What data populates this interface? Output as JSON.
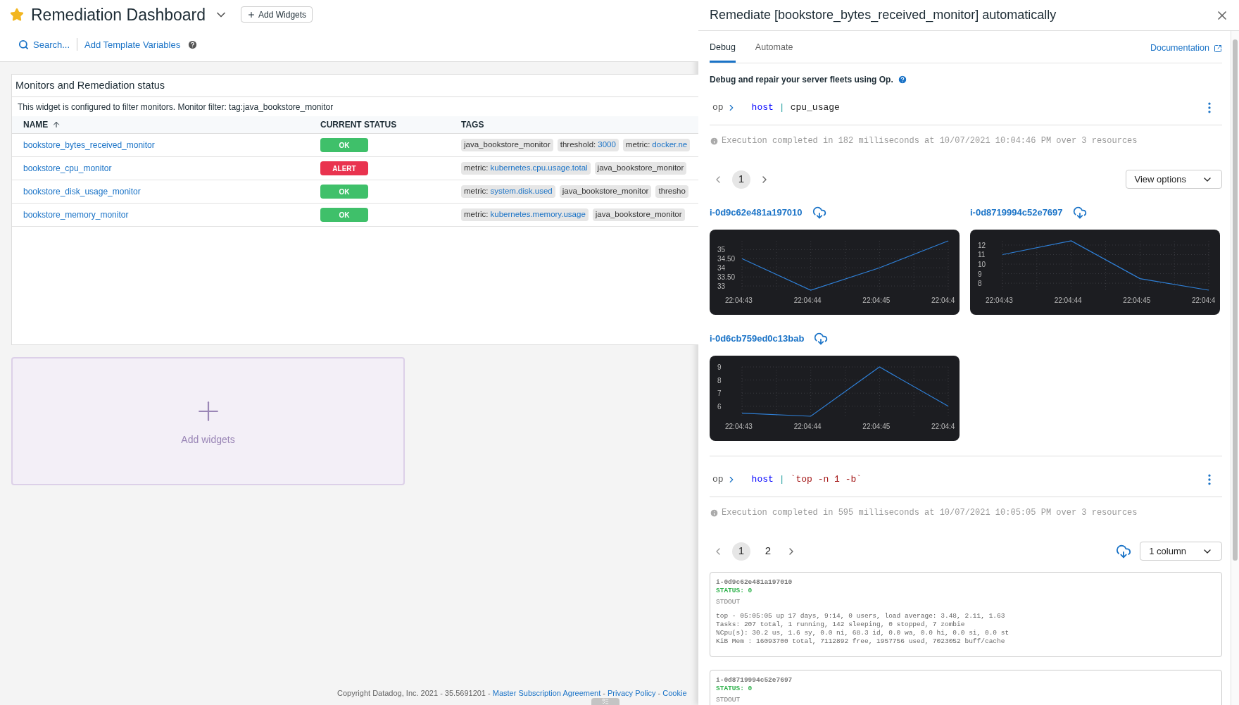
{
  "dashboard": {
    "title": "Remediation Dashboard",
    "starred": true,
    "add_button": "Add Widgets"
  },
  "toolbar": {
    "search": "Search...",
    "template_link": "Add Template Variables"
  },
  "widget": {
    "title": "Monitors and Remediation status",
    "filter_note": "This widget is configured to filter monitors. Monitor filter: tag:java_bookstore_monitor",
    "columns": [
      {
        "label": "NAME",
        "sorted": true
      },
      {
        "label": "CURRENT STATUS",
        "sorted": false
      },
      {
        "label": "TAGS",
        "sorted": false
      }
    ],
    "rows": [
      {
        "name": "bookstore_bytes_received_monitor",
        "status": {
          "label": "OK",
          "kind": "ok"
        },
        "tags": [
          {
            "key": "java_bookstore_monitor"
          },
          {
            "key": "threshold:",
            "value": "3000"
          },
          {
            "key": "metric:",
            "value": "docker.ne"
          }
        ]
      },
      {
        "name": "bookstore_cpu_monitor",
        "status": {
          "label": "ALERT",
          "kind": "alert"
        },
        "tags": [
          {
            "key": "metric:",
            "value": "kubernetes.cpu.usage.total"
          },
          {
            "key": "java_bookstore_monitor"
          }
        ]
      },
      {
        "name": "bookstore_disk_usage_monitor",
        "status": {
          "label": "OK",
          "kind": "ok"
        },
        "tags": [
          {
            "key": "metric:",
            "value": "system.disk.used"
          },
          {
            "key": "java_bookstore_monitor"
          },
          {
            "key": "thresho"
          }
        ]
      },
      {
        "name": "bookstore_memory_monitor",
        "status": {
          "label": "OK",
          "kind": "ok"
        },
        "tags": [
          {
            "key": "metric:",
            "value": "kubernetes.memory.usage"
          },
          {
            "key": "java_bookstore_monitor"
          }
        ]
      }
    ]
  },
  "add_widgets_card": {
    "label": "Add widgets"
  },
  "footer": {
    "parts": [
      {
        "text": "Copyright Datadog, Inc. 2021 - 35.5691201 - ",
        "kind": "plain"
      },
      {
        "text": "Master Subscription Agreement",
        "kind": "link"
      },
      {
        "text": " - ",
        "kind": "plain"
      },
      {
        "text": "Privacy Policy",
        "kind": "link"
      },
      {
        "text": " - ",
        "kind": "plain"
      },
      {
        "text": "Cookie",
        "kind": "link"
      }
    ]
  },
  "panel": {
    "title": "Remediate [bookstore_bytes_received_monitor] automatically",
    "tabs": [
      {
        "label": "Debug",
        "selected": true
      },
      {
        "label": "Automate",
        "selected": false
      }
    ],
    "documentation_link": "Documentation",
    "intro": "Debug and repair your server fleets using Op.",
    "queries": [
      {
        "prompt": "op",
        "command": [
          {
            "text": "host",
            "kind": "keyword"
          },
          {
            "text": "|",
            "kind": "pipe"
          },
          {
            "text": "cpu_usage",
            "kind": "plain"
          }
        ],
        "execution": "Execution completed in 182 milliseconds at 10/07/2021 10:04:46 PM over 3 resources",
        "pages": [
          {
            "label": "1",
            "selected": true
          }
        ],
        "view_button": "View options",
        "download": false,
        "charts": [
          {
            "host": "i-0d9c62e481a197010",
            "chart_data": {
              "type": "line",
              "grid": true,
              "categories": [
                "22:04:43",
                "22:04:44",
                "22:04:45",
                "22:04:4"
              ],
              "ylim": [
                32.77,
                35.48
              ],
              "yticks": [
                33,
                {
                  "value": 33.5,
                  "label": "33.50"
                },
                34,
                {
                  "value": 34.5,
                  "label": "34.50"
                },
                35
              ],
              "series": [
                {
                  "color": "#2f80d8",
                  "values": [
                    34.5,
                    32.77,
                    34,
                    35.48
                  ]
                }
              ]
            }
          },
          {
            "host": "i-0d8719994c52e7697",
            "chart_data": {
              "type": "line",
              "grid": true,
              "categories": [
                "22:04:43",
                "22:04:44",
                "22:04:45",
                "22:04:4"
              ],
              "ylim": [
                7.27,
                12.44
              ],
              "yticks": [
                8,
                9,
                10,
                11,
                12
              ],
              "series": [
                {
                  "color": "#2f80d8",
                  "values": [
                    11,
                    12.44,
                    8.48,
                    7.27
                  ]
                }
              ]
            }
          },
          {
            "host": "i-0d6cb759ed0c13bab",
            "chart_data": {
              "type": "line",
              "grid": true,
              "categories": [
                "22:04:43",
                "22:04:44",
                "22:04:45",
                "22:04:4"
              ],
              "ylim": [
                5.24,
                9
              ],
              "yticks": [
                6,
                7,
                8,
                9
              ],
              "series": [
                {
                  "color": "#2f80d8",
                  "values": [
                    5.47,
                    5.24,
                    9,
                    6
                  ]
                }
              ]
            }
          }
        ]
      },
      {
        "prompt": "op",
        "command": [
          {
            "text": "host",
            "kind": "keyword"
          },
          {
            "text": "|",
            "kind": "pipe"
          },
          {
            "text": "`top -n 1 -b`",
            "kind": "string"
          }
        ],
        "execution": "Execution completed in 595 milliseconds at 10/07/2021 10:05:05 PM over 3 resources",
        "pages": [
          {
            "label": "1",
            "selected": true
          },
          {
            "label": "2",
            "selected": false
          }
        ],
        "view_button": "1 column",
        "download": true,
        "outputs": [
          {
            "host": "i-0d9c62e481a197010",
            "status": "STATUS: 0",
            "stream": "STDOUT",
            "lines": [
              "top - 05:05:05 up 17 days, 9:14, 0 users, load average: 3.48, 2.11, 1.63",
              "Tasks: 207 total, 1 running, 142 sleeping, 0 stopped, 7 zombie",
              "%Cpu(s): 30.2 us, 1.6 sy, 0.0 ni, 68.3 id, 0.0 wa, 0.0 hi, 0.0 si, 0.0 st",
              "KiB Mem : 16093700 total, 7112892 free, 1957756 used, 7023052 buff/cache"
            ]
          },
          {
            "host": "i-0d8719994c52e7697",
            "status": "STATUS: 0",
            "stream": "STDOUT"
          }
        ]
      }
    ]
  }
}
